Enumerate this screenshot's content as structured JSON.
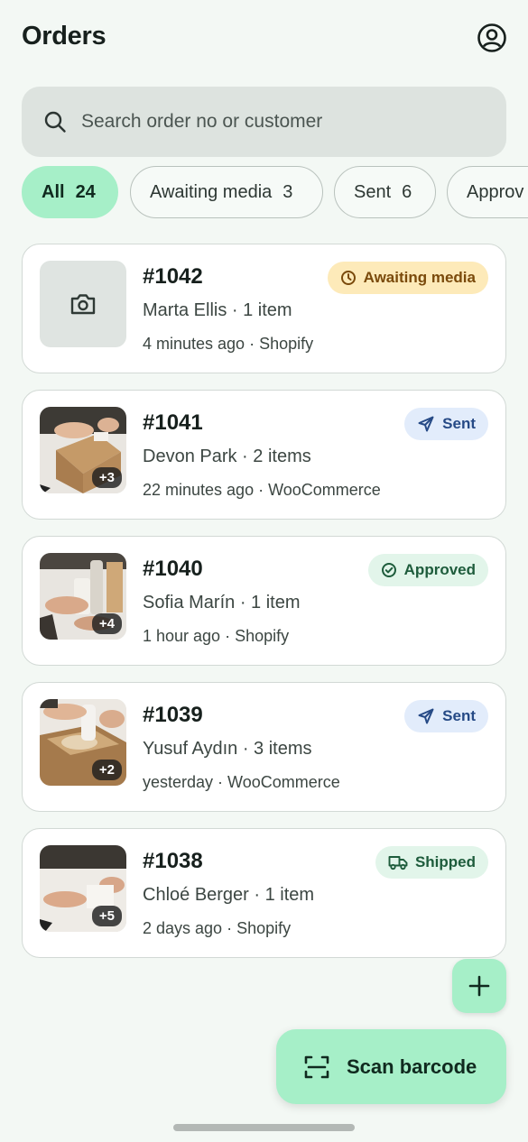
{
  "header": {
    "title": "Orders",
    "profile_icon": "account-circle-icon"
  },
  "search": {
    "placeholder": "Search order no or customer",
    "value": ""
  },
  "filters": [
    {
      "label": "All",
      "count": "24",
      "active": true
    },
    {
      "label": "Awaiting media",
      "count": "3",
      "active": false
    },
    {
      "label": "Sent",
      "count": "6",
      "active": false
    },
    {
      "label": "Approv",
      "count": "",
      "active": false
    }
  ],
  "orders": [
    {
      "number": "#1042",
      "customer": "Marta Ellis · 1 item",
      "meta": "4 minutes ago · Shopify",
      "status": "Awaiting media",
      "thumb_count": ""
    },
    {
      "number": "#1041",
      "customer": "Devon Park · 2 items",
      "meta": "22 minutes ago · WooCommerce",
      "status": "Sent",
      "thumb_count": "+3"
    },
    {
      "number": "#1040",
      "customer": "Sofia Marín · 1 item",
      "meta": "1 hour ago · Shopify",
      "status": "Approved",
      "thumb_count": "+4"
    },
    {
      "number": "#1039",
      "customer": "Yusuf Aydın · 3 items",
      "meta": "yesterday · WooCommerce",
      "status": "Sent",
      "thumb_count": "+2"
    },
    {
      "number": "#1038",
      "customer": "Chloé Berger · 1 item",
      "meta": "2 days ago · Shopify",
      "status": "Shipped",
      "thumb_count": "+5"
    }
  ],
  "actions": {
    "add_label": "+",
    "scan_label": "Scan barcode"
  },
  "colors": {
    "accent": "#a6efc8",
    "background": "#f3f8f4",
    "awaiting": "#fdeab9",
    "sent": "#e2ecfb",
    "approved": "#e2f5ea"
  }
}
